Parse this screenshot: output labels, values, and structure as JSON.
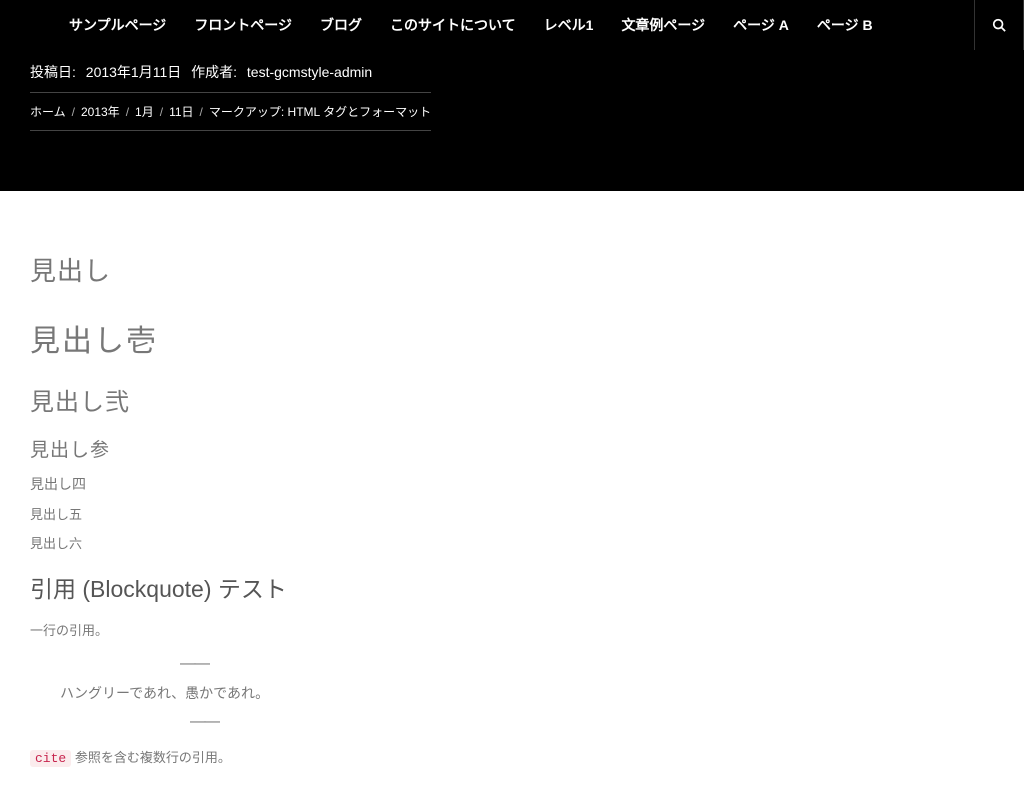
{
  "nav": {
    "items": [
      "サンプルページ",
      "フロントページ",
      "ブログ",
      "このサイトについて",
      "レベル1",
      "文章例ページ",
      "ページ A",
      "ページ B"
    ]
  },
  "meta": {
    "posted_label": "投稿日:",
    "posted_date": "2013年1月11日",
    "author_label": "作成者:",
    "author_name": "test-gcmstyle-admin"
  },
  "breadcrumb": {
    "items": [
      "ホーム",
      "2013年",
      "1月",
      "11日"
    ],
    "current": "マークアップ: HTML タグとフォーマット",
    "sep": "/"
  },
  "content": {
    "intro_heading": "見出し",
    "h1": "見出し壱",
    "h2": "見出し弐",
    "h3": "見出し参",
    "h4": "見出し四",
    "h5": "見出し五",
    "h6": "見出し六",
    "blockquote_title": "引用 (Blockquote) テスト",
    "single_quote": "一行の引用。",
    "dash": "——",
    "bq_text": "ハングリーであれ、愚かであれ。",
    "dash2": "——",
    "cite_code": "cite",
    "cite_text": " 参照を含む複数行の引用。"
  }
}
